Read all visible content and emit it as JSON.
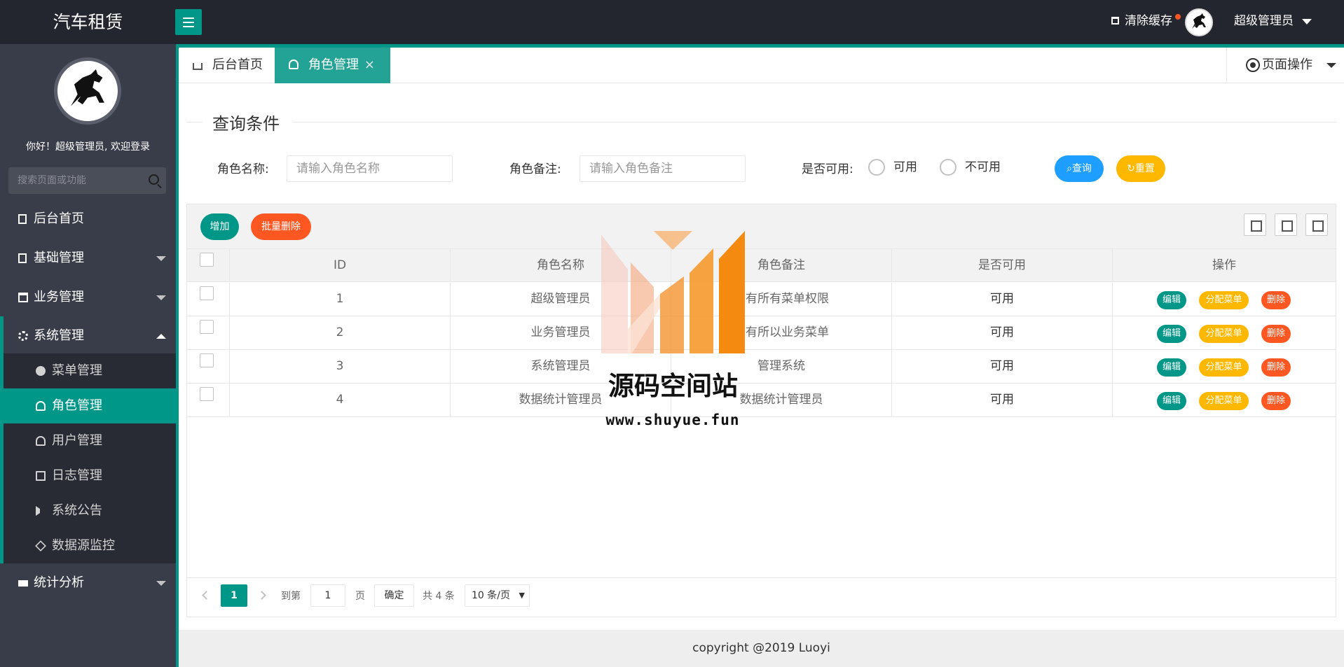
{
  "app": {
    "title": "汽车租赁"
  },
  "header": {
    "clear_cache": "清除缓存",
    "admin_name": "超级管理员"
  },
  "sidebar": {
    "welcome": "你好！超级管理员, 欢迎登录",
    "search_placeholder": "搜索页面或功能",
    "items": [
      {
        "label": "后台首页",
        "icon": "home-icon"
      },
      {
        "label": "基础管理",
        "icon": "file-icon"
      },
      {
        "label": "业务管理",
        "icon": "building-icon"
      },
      {
        "label": "系统管理",
        "icon": "gear-icon"
      },
      {
        "label": "统计分析",
        "icon": "board-icon"
      }
    ],
    "sub_items": [
      {
        "label": "菜单管理",
        "icon": "circle-icon"
      },
      {
        "label": "角色管理",
        "icon": "user-icon"
      },
      {
        "label": "用户管理",
        "icon": "users-icon"
      },
      {
        "label": "日志管理",
        "icon": "note-icon"
      },
      {
        "label": "系统公告",
        "icon": "sound-icon"
      },
      {
        "label": "数据源监控",
        "icon": "cube-icon"
      }
    ]
  },
  "tabs": [
    {
      "label": "后台首页",
      "icon": "home-icon"
    },
    {
      "label": "角色管理",
      "icon": "user-icon",
      "close": "×"
    }
  ],
  "page_ops": "页面操作",
  "query": {
    "legend": "查询条件",
    "name_label": "角色名称:",
    "name_placeholder": "请输入角色名称",
    "remark_label": "角色备注:",
    "remark_placeholder": "请输入角色备注",
    "available_label": "是否可用:",
    "opt_yes": "可用",
    "opt_no": "不可用",
    "search_btn": "查询",
    "reset_btn": "重置"
  },
  "toolbar": {
    "add": "增加",
    "batch_delete": "批量删除"
  },
  "table": {
    "headers": [
      "ID",
      "角色名称",
      "角色备注",
      "是否可用",
      "操作"
    ],
    "rows": [
      {
        "id": "1",
        "name": "超级管理员",
        "remark": "拥有所有菜单权限",
        "available": "可用"
      },
      {
        "id": "2",
        "name": "业务管理员",
        "remark": "拥有所以业务菜单",
        "available": "可用"
      },
      {
        "id": "3",
        "name": "系统管理员",
        "remark": "管理系统",
        "available": "可用"
      },
      {
        "id": "4",
        "name": "数据统计管理员",
        "remark": "数据统计管理员",
        "available": "可用"
      }
    ],
    "actions": {
      "edit": "编辑",
      "assign": "分配菜单",
      "delete": "删除"
    }
  },
  "pager": {
    "current": "1",
    "goto": "到第",
    "goto_value": "1",
    "page_unit": "页",
    "confirm": "确定",
    "total": "共 4 条",
    "page_size": "10 条/页"
  },
  "footer": "copyright @2019 Luoyi",
  "watermark": {
    "text": "源码空间站",
    "url": "www.shuyue.fun"
  },
  "colors": {
    "accent": "#009688",
    "blue": "#1e9fff",
    "yellow": "#ffb800",
    "red": "#ff5722",
    "dark": "#23262e"
  }
}
